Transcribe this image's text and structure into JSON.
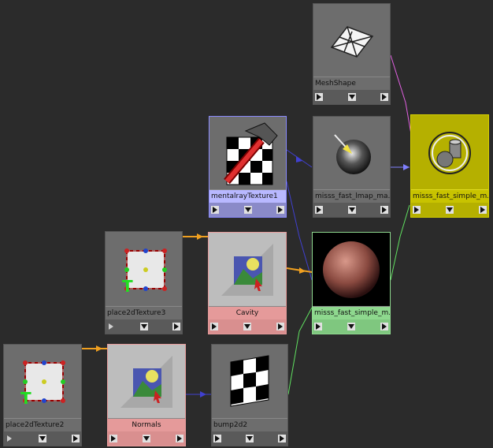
{
  "nodes": {
    "meshshape": {
      "label": "MeshShape",
      "icon": "mesh-icon"
    },
    "mentalray_texture": {
      "label": "mentalrayTexture1",
      "icon": "mentalray-texture-icon"
    },
    "lmap": {
      "label": "misss_fast_lmap_ma...",
      "icon": "lmap-sphere-icon"
    },
    "simple_maya": {
      "label": "misss_fast_simple_m...",
      "icon": "shader-cylinder-icon"
    },
    "place2d3": {
      "label": "place2dTexture3",
      "icon": "place2d-icon"
    },
    "cavity": {
      "label": "Cavity",
      "icon": "file-texture-icon"
    },
    "simple_mi": {
      "label": "misss_fast_simple_m...",
      "icon": "sss-sphere-icon"
    },
    "place2d2": {
      "label": "place2dTexture2",
      "icon": "place2d-icon"
    },
    "normals": {
      "label": "Normals",
      "icon": "file-texture-icon"
    },
    "bump2d2": {
      "label": "bump2d2",
      "icon": "bump-checker-icon"
    }
  },
  "colors": {
    "background": "#2b2b2b",
    "selected": "#b8b8ff",
    "file_node": "#e59a9a",
    "shader_node": "#8ed88e",
    "sg_node": "#c8c300",
    "wire_orange": "#f0a020",
    "wire_blue": "#4040d0",
    "wire_green": "#60e060",
    "wire_pink": "#e060e0"
  }
}
